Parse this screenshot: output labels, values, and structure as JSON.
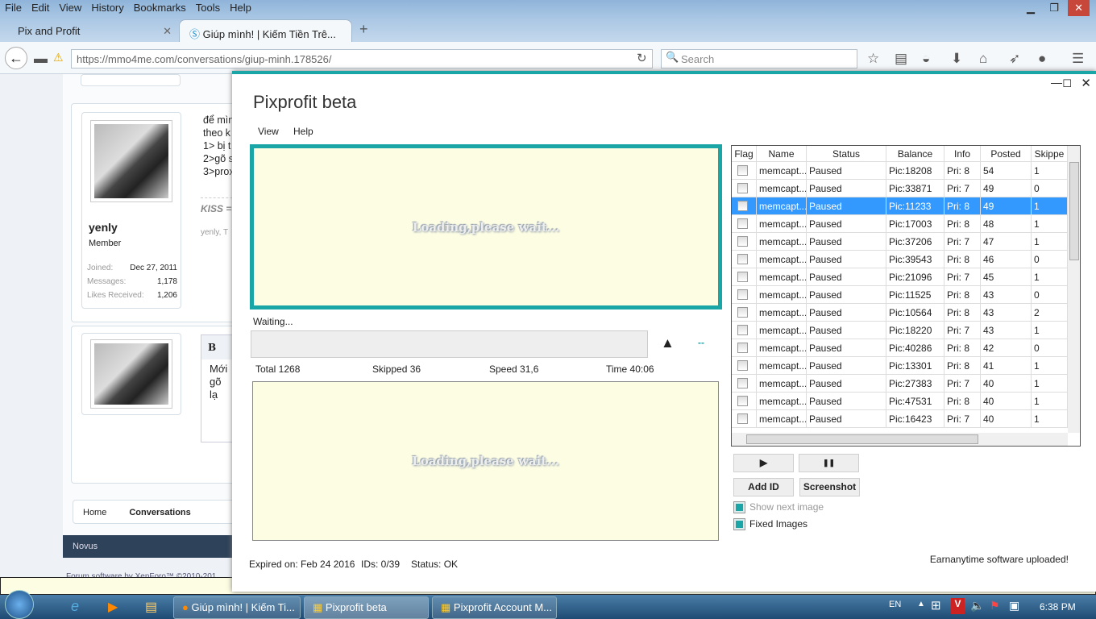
{
  "browser": {
    "menu": [
      "File",
      "Edit",
      "View",
      "History",
      "Bookmarks",
      "Tools",
      "Help"
    ],
    "tabs": [
      {
        "label": "Pix and Profit"
      },
      {
        "label": "Giúp mình! | Kiếm Tiền Trê..."
      }
    ],
    "url": "https://mmo4me.com/conversations/giup-minh.178526/",
    "search_placeholder": "Search"
  },
  "forum": {
    "post_lines": [
      "để mìn",
      "theo k",
      "1> bị t",
      "2>gõ s",
      "3>prox"
    ],
    "signature": "KISS =",
    "likes": "yenly, T",
    "username": "yenly",
    "role": "Member",
    "stats": [
      {
        "label": "Joined:",
        "value": "Dec 27, 2011"
      },
      {
        "label": "Messages:",
        "value": "1,178"
      },
      {
        "label": "Likes Received:",
        "value": "1,206"
      }
    ],
    "editor_bold": "B",
    "reply_lines": [
      "Mới",
      "gõ lạ"
    ],
    "breadcrumb": [
      "Home",
      "Conversations"
    ],
    "footer_style": "Novus",
    "copyright": "Forum software by XenForo™ ©2010-201"
  },
  "app": {
    "title": "Pixprofit beta",
    "menu": [
      "View",
      "Help"
    ],
    "loading_text": "Loading,please wait...",
    "status": "Waiting...",
    "arrow": "▲",
    "dash": "--",
    "stats": {
      "total": "Total 1268",
      "skipped": "Skipped 36",
      "speed": "Speed 31,6",
      "time": "Time 40:06"
    },
    "columns": [
      "Flag",
      "Name",
      "Status",
      "Balance",
      "Info",
      "Posted",
      "Skippe"
    ],
    "rows": [
      {
        "name": "memcapt...",
        "status": "Paused",
        "balance": "Pic:18208",
        "info": "Pri: 8",
        "posted": "54",
        "skipped": "1"
      },
      {
        "name": "memcapt...",
        "status": "Paused",
        "balance": "Pic:33871",
        "info": "Pri: 7",
        "posted": "49",
        "skipped": "0"
      },
      {
        "name": "memcapt...",
        "status": "Paused",
        "balance": "Pic:11233",
        "info": "Pri: 8",
        "posted": "49",
        "skipped": "1",
        "selected": true
      },
      {
        "name": "memcapt...",
        "status": "Paused",
        "balance": "Pic:17003",
        "info": "Pri: 8",
        "posted": "48",
        "skipped": "1"
      },
      {
        "name": "memcapt...",
        "status": "Paused",
        "balance": "Pic:37206",
        "info": "Pri: 7",
        "posted": "47",
        "skipped": "1"
      },
      {
        "name": "memcapt...",
        "status": "Paused",
        "balance": "Pic:39543",
        "info": "Pri: 8",
        "posted": "46",
        "skipped": "0"
      },
      {
        "name": "memcapt...",
        "status": "Paused",
        "balance": "Pic:21096",
        "info": "Pri: 7",
        "posted": "45",
        "skipped": "1"
      },
      {
        "name": "memcapt...",
        "status": "Paused",
        "balance": "Pic:11525",
        "info": "Pri: 8",
        "posted": "43",
        "skipped": "0"
      },
      {
        "name": "memcapt...",
        "status": "Paused",
        "balance": "Pic:10564",
        "info": "Pri: 8",
        "posted": "43",
        "skipped": "2"
      },
      {
        "name": "memcapt...",
        "status": "Paused",
        "balance": "Pic:18220",
        "info": "Pri: 7",
        "posted": "43",
        "skipped": "1"
      },
      {
        "name": "memcapt...",
        "status": "Paused",
        "balance": "Pic:40286",
        "info": "Pri: 8",
        "posted": "42",
        "skipped": "0"
      },
      {
        "name": "memcapt...",
        "status": "Paused",
        "balance": "Pic:13301",
        "info": "Pri: 8",
        "posted": "41",
        "skipped": "1"
      },
      {
        "name": "memcapt...",
        "status": "Paused",
        "balance": "Pic:27383",
        "info": "Pri: 7",
        "posted": "40",
        "skipped": "1"
      },
      {
        "name": "memcapt...",
        "status": "Paused",
        "balance": "Pic:47531",
        "info": "Pri: 8",
        "posted": "40",
        "skipped": "1"
      },
      {
        "name": "memcapt...",
        "status": "Paused",
        "balance": "Pic:16423",
        "info": "Pri: 7",
        "posted": "40",
        "skipped": "1"
      }
    ],
    "buttons": {
      "play": "▶",
      "pause": "❚❚",
      "add_id": "Add ID",
      "screenshot": "Screenshot"
    },
    "checkboxes": {
      "show_next": "Show next image",
      "fixed": "Fixed Images"
    },
    "footer": {
      "expired": "Expired on: Feb 24 2016",
      "ids": "IDs: 0/39",
      "status": "Status: OK",
      "message": "Earnanytime software uploaded!"
    },
    "accent": "#1aa6a6"
  },
  "taskbar": {
    "items": [
      "Giúp mình! | Kiếm Ti...",
      "Pixprofit beta",
      "Pixprofit Account M..."
    ],
    "lang": "EN",
    "clock": "6:38 PM"
  }
}
